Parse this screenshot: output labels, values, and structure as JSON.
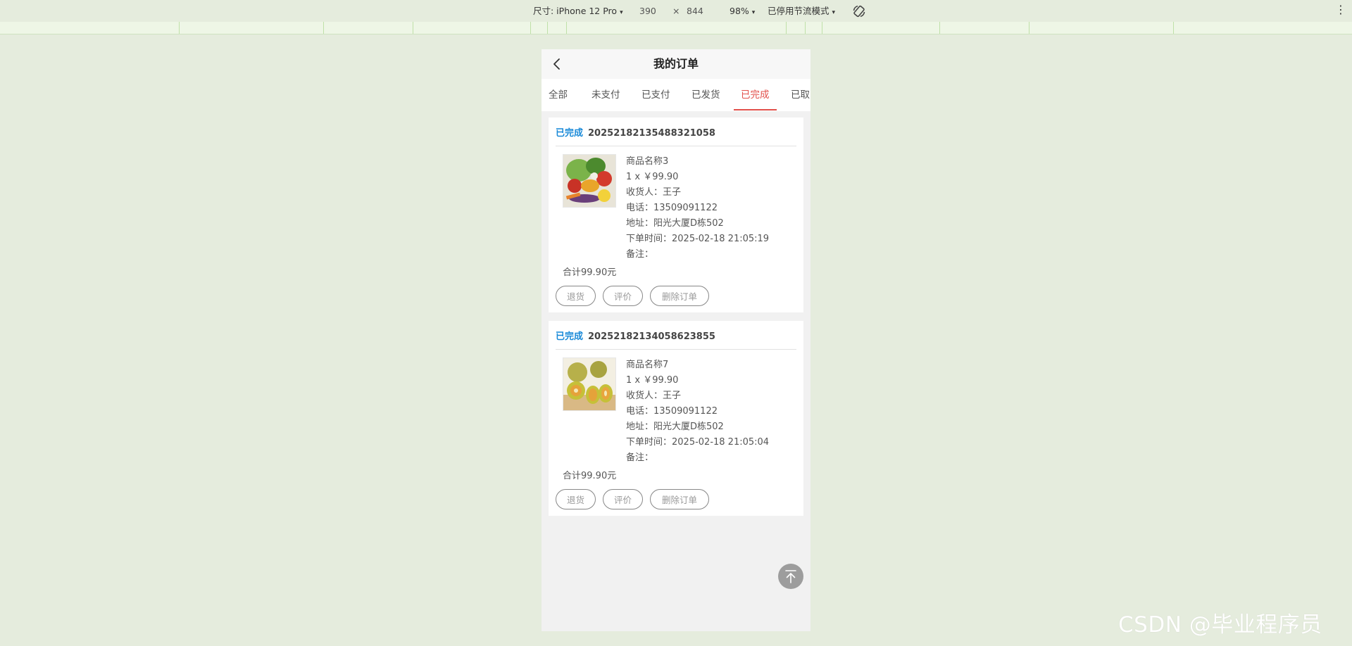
{
  "devtools": {
    "dimensions_label": "尺寸: iPhone 12 Pro",
    "width": "390",
    "times": "×",
    "height": "844",
    "zoom": "98%",
    "throttle": "已停用节流模式",
    "caret": "▾",
    "more": "⋮"
  },
  "header": {
    "title": "我的订单"
  },
  "tabs": [
    {
      "label": "全部"
    },
    {
      "label": "未支付"
    },
    {
      "label": "已支付"
    },
    {
      "label": "已发货"
    },
    {
      "label": "已完成"
    },
    {
      "label": "已取"
    }
  ],
  "active_tab": "已完成",
  "orders": [
    {
      "status": "已完成",
      "order_no": "20252182135488321058",
      "image": "vegetables",
      "product": "商品名称3",
      "quantity_price": "1 x ￥99.90",
      "receiver": "收货人：王子",
      "phone": "电话：13509091122",
      "address": "地址：阳光大厦D栋502",
      "order_time": "下单时间：2025-02-18 21:05:19",
      "note": "备注：",
      "total": "合计99.90元",
      "buttons": {
        "return": "退货",
        "review": "评价",
        "delete": "删除订单"
      }
    },
    {
      "status": "已完成",
      "order_no": "20252182134058623855",
      "image": "kiwi",
      "product": "商品名称7",
      "quantity_price": "1 x ￥99.90",
      "receiver": "收货人：王子",
      "phone": "电话：13509091122",
      "address": "地址：阳光大厦D栋502",
      "order_time": "下单时间：2025-02-18 21:05:04",
      "note": "备注：",
      "total": "合计99.90元",
      "buttons": {
        "return": "退货",
        "review": "评价",
        "delete": "删除订单"
      }
    }
  ],
  "icons": {
    "back": "chevron-left-icon",
    "totop": "arrow-up-to-top-icon",
    "rotate": "rotate-device-icon"
  },
  "colors": {
    "status": "#1a8ad8",
    "active_tab": "#e2504b"
  },
  "watermark": "CSDN @毕业程序员"
}
